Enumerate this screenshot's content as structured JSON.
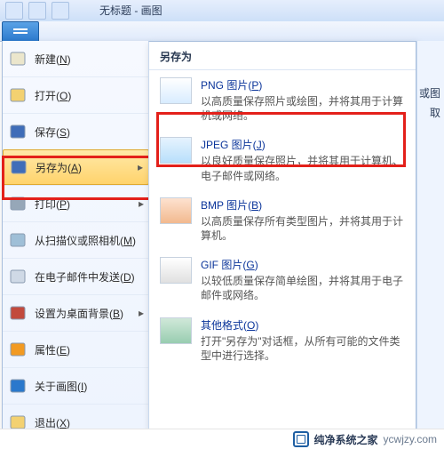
{
  "window": {
    "title": "无标题 - 画图"
  },
  "menu": {
    "items": [
      {
        "label": "新建(N)",
        "name": "menu-new",
        "iconColor": "#ebe6cc"
      },
      {
        "label": "打开(O)",
        "name": "menu-open",
        "iconColor": "#f3d171"
      },
      {
        "label": "保存(S)",
        "name": "menu-save",
        "iconColor": "#3f6db8"
      },
      {
        "label": "另存为(A)",
        "name": "menu-save-as",
        "iconColor": "#3f6db8",
        "selected": true,
        "hasSub": true
      },
      {
        "label": "打印(P)",
        "name": "menu-print",
        "iconColor": "#96a7b8",
        "hasSub": true
      },
      {
        "label": "从扫描仪或照相机(M)",
        "name": "menu-acquire",
        "iconColor": "#9fbfd7"
      },
      {
        "label": "在电子邮件中发送(D)",
        "name": "menu-email",
        "iconColor": "#cfd9e6"
      },
      {
        "label": "设置为桌面背景(B)",
        "name": "menu-wallpaper",
        "iconColor": "#c24a3d",
        "hasSub": true
      },
      {
        "label": "属性(E)",
        "name": "menu-properties",
        "iconColor": "#f29a22"
      },
      {
        "label": "关于画图(I)",
        "name": "menu-about",
        "iconColor": "#2a78cc"
      },
      {
        "label": "退出(X)",
        "name": "menu-exit",
        "iconColor": "#f3d171"
      }
    ]
  },
  "saveAs": {
    "header": "另存为",
    "options": [
      {
        "name": "saveas-png",
        "title": "PNG 图片(P)",
        "desc": "以高质量保存照片或绘图，并将其用于计算机或网络。",
        "thumb": "png"
      },
      {
        "name": "saveas-jpeg",
        "title": "JPEG 图片(J)",
        "desc": "以良好质量保存照片，并将其用于计算机、电子邮件或网络。",
        "thumb": "jpeg",
        "highlight": true
      },
      {
        "name": "saveas-bmp",
        "title": "BMP 图片(B)",
        "desc": "以高质量保存所有类型图片，并将其用于计算机。",
        "thumb": "bmp"
      },
      {
        "name": "saveas-gif",
        "title": "GIF 图片(G)",
        "desc": "以较低质量保存简单绘图，并将其用于电子邮件或网络。",
        "thumb": "gif"
      },
      {
        "name": "saveas-other",
        "title": "其他格式(O)",
        "desc": "打开\"另存为\"对话框，从所有可能的文件类型中进行选择。",
        "thumb": "oth"
      }
    ]
  },
  "right": {
    "clip1": "或图",
    "clip2": "取"
  },
  "watermark": {
    "brand": "纯净系统之家",
    "url": "ycwjzy.com"
  }
}
